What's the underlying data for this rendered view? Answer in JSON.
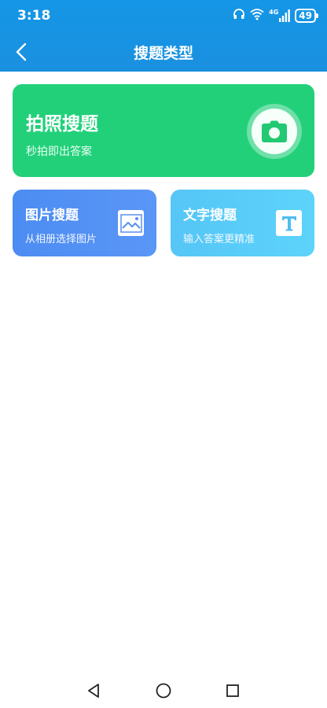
{
  "status_bar": {
    "time": "3:18",
    "network": "4G",
    "battery": "49"
  },
  "nav": {
    "title": "搜题类型",
    "back_icon": "chevron-left-icon"
  },
  "cards": {
    "camera": {
      "title": "拍照搜题",
      "subtitle": "秒拍即出答案",
      "icon": "camera-icon",
      "color": "#22d07a"
    },
    "image": {
      "title": "图片搜题",
      "subtitle": "从相册选择图片",
      "icon": "image-icon",
      "color": "#4c8cf2"
    },
    "text": {
      "title": "文字搜题",
      "subtitle": "输入答案更精准",
      "icon": "text-t-icon",
      "color": "#55c6f6"
    }
  },
  "colors": {
    "header": "#1596e6",
    "background": "#ffffff"
  },
  "system_nav": [
    "back-triangle-icon",
    "home-circle-icon",
    "recents-square-icon"
  ]
}
